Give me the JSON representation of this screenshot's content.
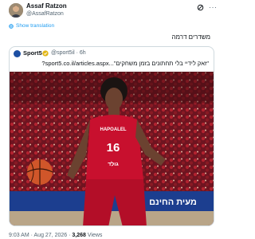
{
  "post": {
    "author_name": "Assaf Ratzon",
    "author_handle": "@AssafRatzon",
    "translate_label": "Show translation",
    "text": "משדרים דרמה",
    "timestamp": "9:03 AM · Aug 27, 2026",
    "separator": " · ",
    "views_count": "3,268",
    "views_label": " Views"
  },
  "quoted": {
    "name": "Sport5",
    "handle": "@sport5il · 6h",
    "text": "\"זאק לידיי בלי תחתונים בזמן משחקים\"...sport5.co.il/articles.aspx?",
    "jersey_brand": "HAPOALEL",
    "jersey_number": "16",
    "jersey_sponsor": "גולד",
    "court_banner": "מעית החינם"
  },
  "colors": {
    "link": "#1d9bf0",
    "muted": "#536471",
    "jersey": "#c8102e"
  },
  "icons": {
    "grok": "grok-icon",
    "more": "more-icon",
    "translate": "globe-icon",
    "verified": "verified-badge-icon"
  }
}
